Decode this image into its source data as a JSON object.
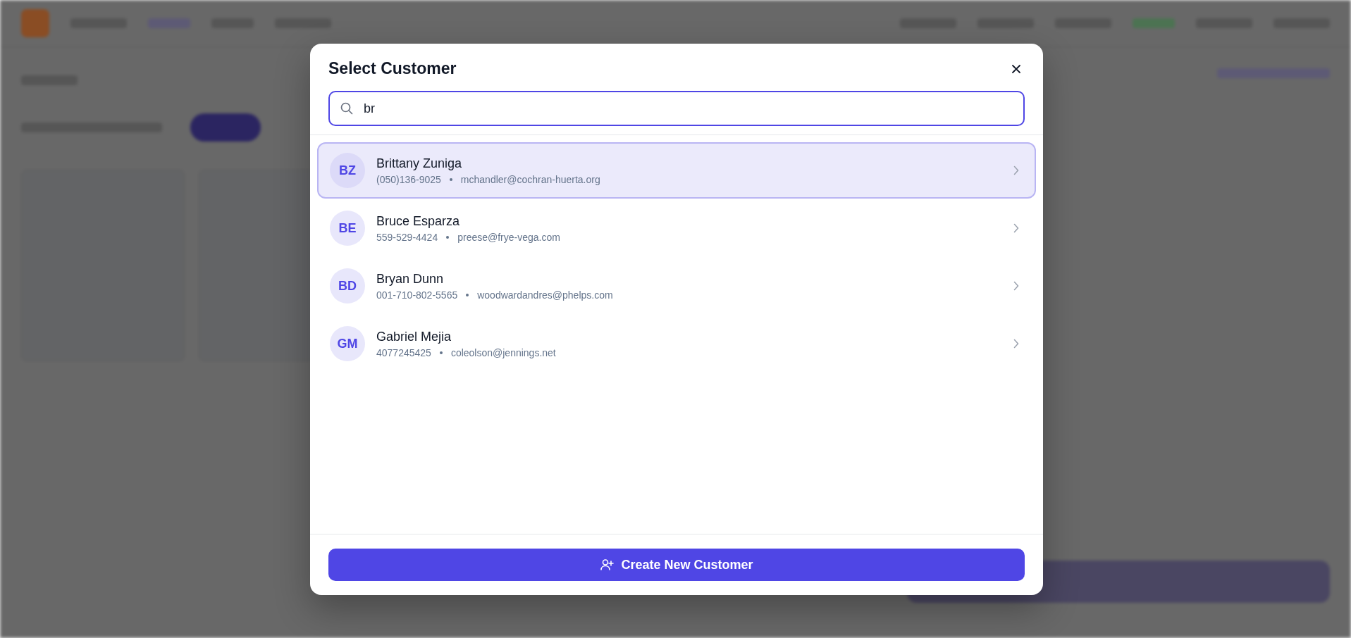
{
  "dialog": {
    "title": "Select Customer",
    "search": {
      "value": "br"
    },
    "customers": [
      {
        "initials": "BZ",
        "name": "Brittany Zuniga",
        "phone": "(050)136-9025",
        "email": "mchandler@cochran-huerta.org",
        "selected": true
      },
      {
        "initials": "BE",
        "name": "Bruce Esparza",
        "phone": "559-529-4424",
        "email": "preese@frye-vega.com",
        "selected": false
      },
      {
        "initials": "BD",
        "name": "Bryan Dunn",
        "phone": "001-710-802-5565",
        "email": "woodwardandres@phelps.com",
        "selected": false
      },
      {
        "initials": "GM",
        "name": "Gabriel Mejia",
        "phone": "4077245425",
        "email": "coleolson@jennings.net",
        "selected": false
      }
    ],
    "create_button": {
      "label": "Create New Customer"
    }
  }
}
